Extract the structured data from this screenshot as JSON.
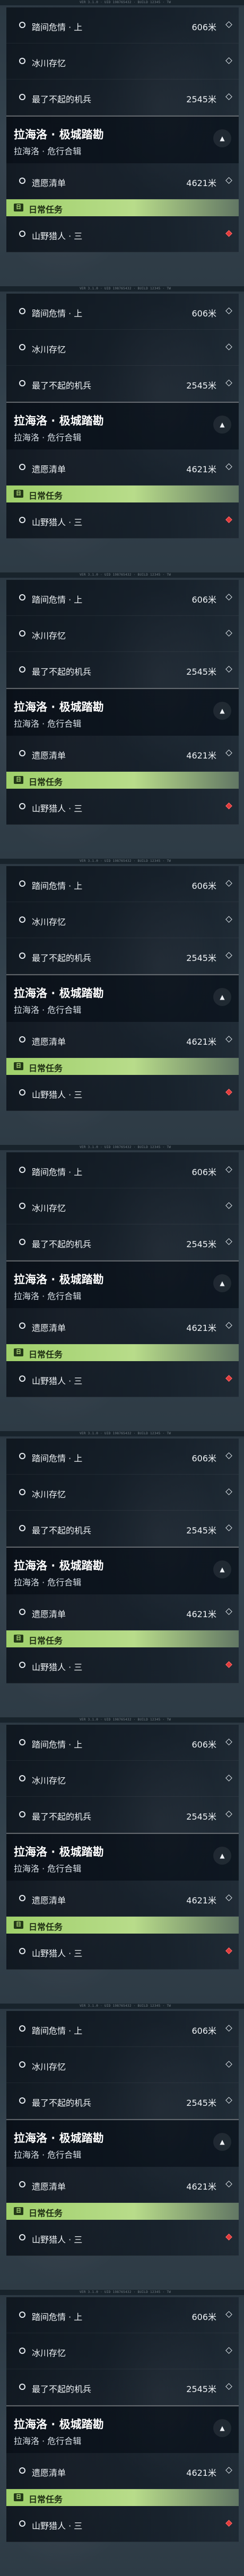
{
  "version_text": "VER 3.1.0 · UID 198765432 · BUILD 12345 · TW",
  "header": {
    "title": "拉海洛 · 极城踏勘",
    "subtitle": "拉海洛 · 危行合辑",
    "collapse_glyph": "▲"
  },
  "daily_section": {
    "label": "日常任务",
    "icon_text": "日"
  },
  "tasks_top": [
    {
      "name": "踏间危情 · 上",
      "distance": "606米",
      "marker": "diamond"
    },
    {
      "name": "冰川存忆",
      "distance": "",
      "marker": "diamond"
    },
    {
      "name": "最了不起的机兵",
      "distance": "2545米",
      "marker": "diamond"
    }
  ],
  "tasks_header": [
    {
      "name": "遗愿清单",
      "distance": "4621米",
      "marker": "diamond"
    }
  ],
  "tasks_daily": [
    {
      "name": "山野猎人 · 三",
      "distance": "",
      "marker": "diamond-red"
    }
  ],
  "colors": {
    "daily_green": "#9fd06a",
    "marker_red": "#e13a3a"
  }
}
